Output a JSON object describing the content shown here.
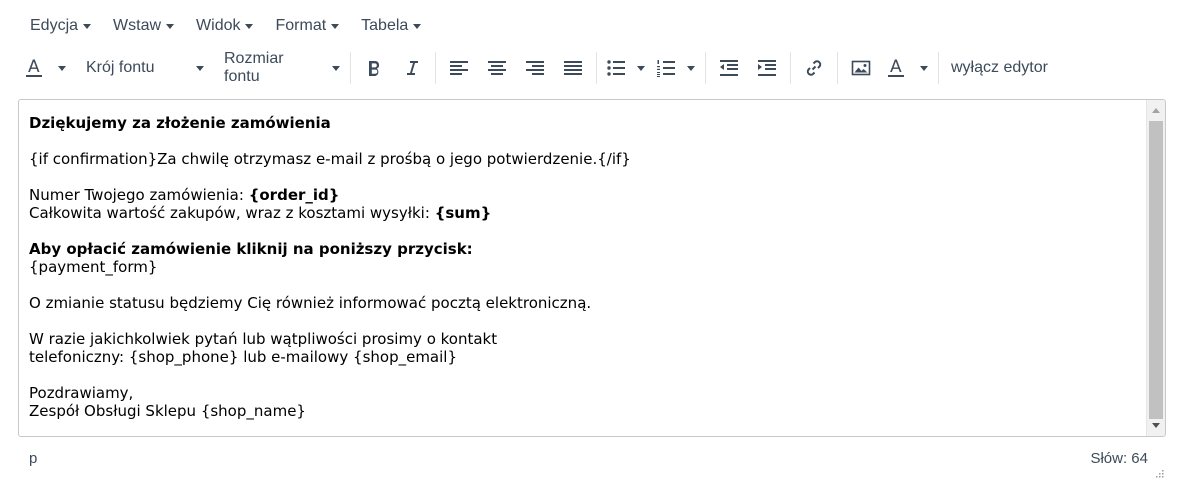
{
  "menubar": {
    "items": [
      "Edycja",
      "Wstaw",
      "Widok",
      "Format",
      "Tabela"
    ]
  },
  "toolbar": {
    "font_family": "Krój fontu",
    "font_size": "Rozmiar fontu",
    "disable_editor": "wyłącz edytor",
    "text_color_glyph": "A",
    "bg_color_glyph": "A",
    "icons": [
      "text-color-icon",
      "bold-icon",
      "italic-icon",
      "align-left-icon",
      "align-center-icon",
      "align-right-icon",
      "align-justify-icon",
      "bullet-list-icon",
      "numbered-list-icon",
      "outdent-icon",
      "indent-icon",
      "link-icon",
      "image-icon",
      "background-color-icon"
    ],
    "accent_underline_color": "#3c4a5a"
  },
  "editor": {
    "heading": "Dziękujemy za złożenie zamówienia",
    "line_confirmation": "{if confirmation}Za chwilę otrzymasz e-mail z prośbą o jego potwierdzenie.{/if}",
    "order_label": "Numer Twojego zamówienia: ",
    "order_value": "{order_id}",
    "sum_label": "Całkowita wartość zakupów, wraz z kosztami wysyłki: ",
    "sum_value": "{sum}",
    "payment_heading": "Aby opłacić zamówienie kliknij na poniższy przycisk:",
    "payment_form": "{payment_form}",
    "status_info": "O zmianie statusu będziemy Cię również informować pocztą elektroniczną.",
    "contact_line1": "W razie jakichkolwiek pytań lub wątpliwości prosimy o kontakt",
    "contact_line2": "telefoniczny: {shop_phone} lub e-mailowy {shop_email}",
    "greeting": "Pozdrawiamy,",
    "signature": "Zespół Obsługi Sklepu {shop_name}"
  },
  "statusbar": {
    "path": "p",
    "word_count": "Słów: 64"
  }
}
